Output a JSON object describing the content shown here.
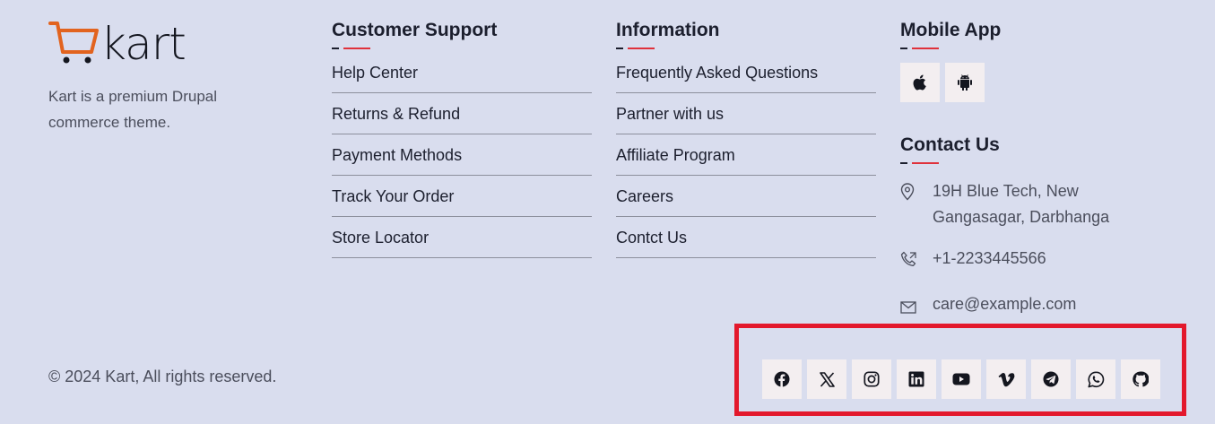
{
  "brand": {
    "logo_text": "kart",
    "tagline": "Kart is a premium Drupal commerce theme."
  },
  "customer_support": {
    "heading": "Customer Support",
    "links": [
      "Help Center",
      "Returns & Refund",
      "Payment Methods",
      "Track Your Order",
      "Store Locator"
    ]
  },
  "information": {
    "heading": "Information",
    "links": [
      "Frequently Asked Questions",
      "Partner with us",
      "Affiliate Program",
      "Careers",
      "Contct Us"
    ]
  },
  "mobile_app": {
    "heading": "Mobile App",
    "buttons": [
      {
        "icon": "apple-icon"
      },
      {
        "icon": "android-icon"
      }
    ]
  },
  "contact": {
    "heading": "Contact Us",
    "address": "19H Blue Tech, New Gangasagar, Darbhanga",
    "phone": "+1-2233445566",
    "email": "care@example.com"
  },
  "copyright": "© 2024 Kart, All rights reserved.",
  "social": [
    {
      "icon": "facebook-icon"
    },
    {
      "icon": "x-twitter-icon"
    },
    {
      "icon": "instagram-icon"
    },
    {
      "icon": "linkedin-icon"
    },
    {
      "icon": "youtube-icon"
    },
    {
      "icon": "vimeo-icon"
    },
    {
      "icon": "telegram-icon"
    },
    {
      "icon": "whatsapp-icon"
    },
    {
      "icon": "github-icon"
    }
  ],
  "colors": {
    "background": "#d9ddee",
    "accent_red": "#e0313b",
    "highlight_box": "#e3182c",
    "logo_orange": "#e2631e",
    "icon_button_bg": "#f3eef0"
  }
}
